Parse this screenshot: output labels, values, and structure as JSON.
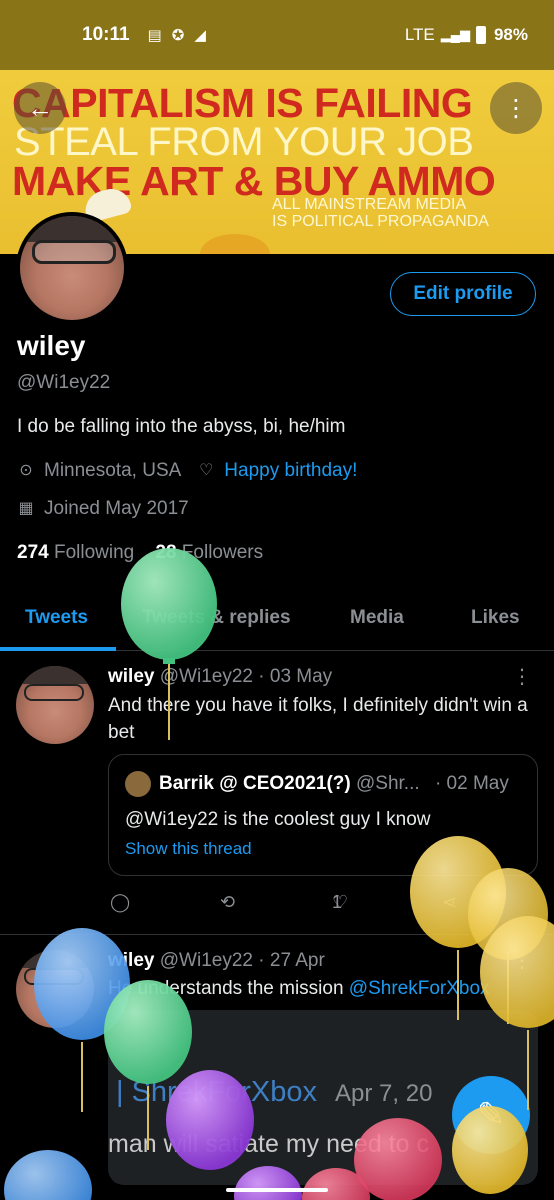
{
  "status_bar": {
    "time": "10:11",
    "network": "LTE",
    "battery": "98%"
  },
  "banner": {
    "line1": "CAPITALISM IS FAILING",
    "line2": "STEAL FROM YOUR JOB",
    "line3": "MAKE ART & BUY AMMO",
    "line4a": "ALL MAINSTREAM MEDIA",
    "line4b": "IS POLITICAL PROPAGANDA"
  },
  "profile": {
    "edit_label": "Edit profile",
    "name": "wiley",
    "handle": "@Wi1ey22",
    "bio": "I do be falling into the abyss, bi, he/him",
    "location": "Minnesota, USA",
    "birthday": "Happy birthday!",
    "joined": "Joined May 2017",
    "following_count": "274",
    "following_label": "Following",
    "followers_count": "28",
    "followers_label": "Followers"
  },
  "tabs": [
    "Tweets",
    "Tweets & replies",
    "Media",
    "Likes"
  ],
  "tweets": [
    {
      "name": "wiley",
      "handle": "@Wi1ey22",
      "date": "· 03 May",
      "text": "And there you have it folks, I definitely didn't win a bet",
      "quote": {
        "name": "Barrik @ CEO2021(?)",
        "handle": "@Shr...",
        "date": "· 02 May",
        "text": "@Wi1ey22 is the coolest guy I know",
        "link": "Show this thread"
      },
      "likes": "1"
    },
    {
      "name": "wiley",
      "handle": "@Wi1ey22",
      "date": "· 27 Apr",
      "text_prefix": "He understands the mission",
      "text_mention": "@ShrekForXbox",
      "media_line1": "| ShrekForXbox",
      "media_date": "Apr 7, 20",
      "media_line2": "man will satiate my need to c"
    }
  ],
  "colors": {
    "accent": "#1d9bf0",
    "background": "#000000",
    "status_bar": "#8a7418"
  }
}
